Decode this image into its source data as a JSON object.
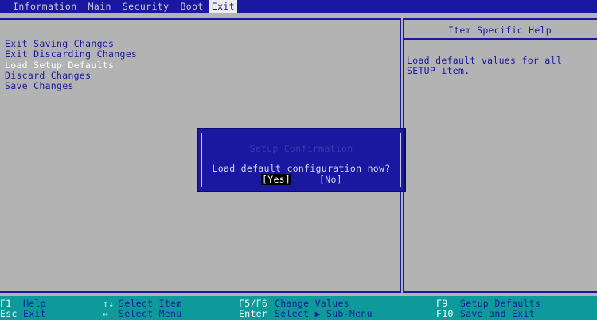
{
  "menu": {
    "tabs": [
      "Information",
      "Main",
      "Security",
      "Boot",
      "Exit"
    ],
    "active": "Exit"
  },
  "exit_menu": {
    "items": [
      "Exit Saving Changes",
      "Exit Discarding Changes",
      "Load Setup Defaults",
      "Discard Changes",
      "Save Changes"
    ],
    "selected": "Load Setup Defaults"
  },
  "help": {
    "title": "Item Specific Help",
    "lines": [
      "Load default values for all",
      "SETUP item."
    ]
  },
  "dialog": {
    "title": "Setup Confirmation",
    "message": "Load default configuration now?",
    "yes": "[Yes]",
    "no": "[No]"
  },
  "footer": {
    "row1": [
      {
        "key": "F1",
        "desc": "Help"
      },
      {
        "key": "↑↓",
        "desc": "Select Item"
      },
      {
        "key": "F5/F6",
        "desc": "Change Values"
      },
      {
        "key": "F9",
        "desc": "Setup Defaults"
      }
    ],
    "row2": [
      {
        "key": "Esc",
        "desc": "Exit"
      },
      {
        "key": "↔",
        "desc": "Select Menu"
      },
      {
        "key": "Enter",
        "desc": "Select ▶ Sub-Menu"
      },
      {
        "key": "F10",
        "desc": "Save and Exit"
      }
    ]
  },
  "colors": {
    "background": "#b3b3b3",
    "bios_blue": "#1a18a0",
    "footer_teal": "#0e9a9a"
  }
}
